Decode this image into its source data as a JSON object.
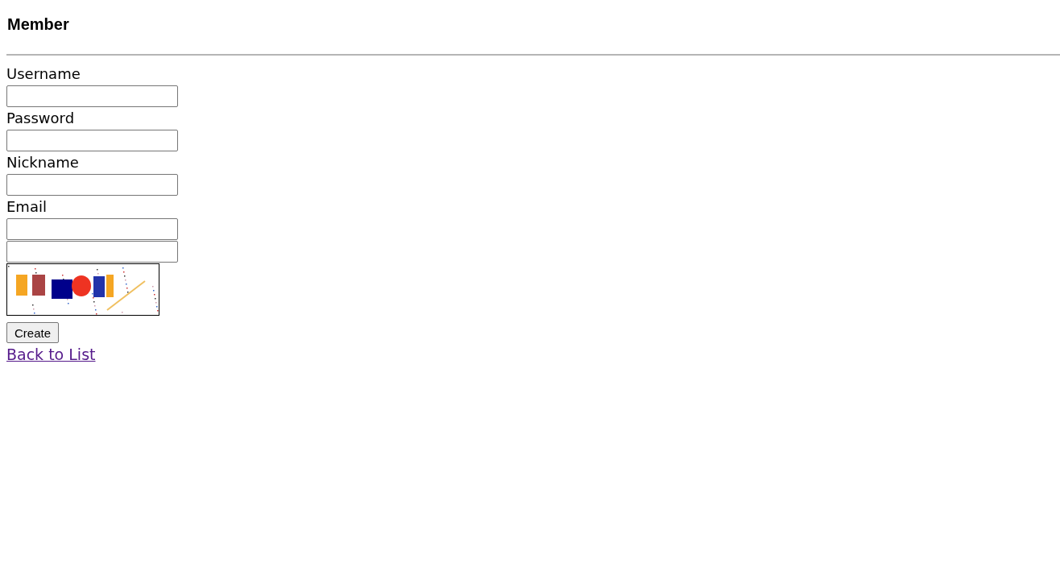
{
  "heading": "Member",
  "fields": [
    {
      "kind": "labeled",
      "label": "Username"
    },
    {
      "kind": "labeled",
      "label": "Password"
    },
    {
      "kind": "labeled",
      "label": "Nickname"
    },
    {
      "kind": "labeled",
      "label": "Email"
    },
    {
      "kind": "plain"
    },
    {
      "kind": "picture"
    }
  ],
  "submit": "Create",
  "back_link": "Back to List"
}
